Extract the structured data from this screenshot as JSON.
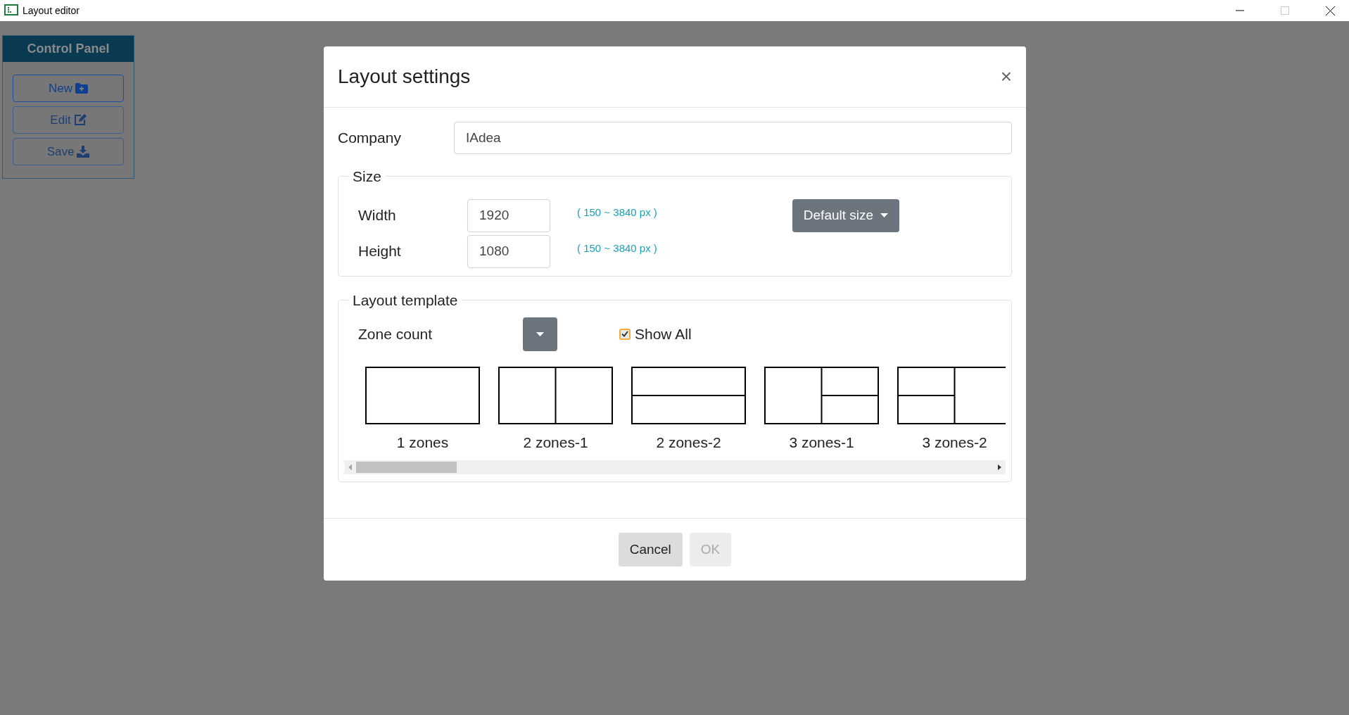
{
  "window": {
    "title": "Layout editor"
  },
  "control_panel": {
    "title": "Control Panel",
    "buttons": [
      {
        "label": "New",
        "kind": "new",
        "disabled": false
      },
      {
        "label": "Edit",
        "kind": "edit",
        "disabled": true
      },
      {
        "label": "Save",
        "kind": "save",
        "disabled": true
      }
    ]
  },
  "dialog": {
    "title": "Layout settings",
    "close": "×",
    "company": {
      "label": "Company",
      "value": "IAdea"
    },
    "size": {
      "legend": "Size",
      "width": {
        "label": "Width",
        "value": "1920",
        "hint": "( 150 ~ 3840 px )"
      },
      "height": {
        "label": "Height",
        "value": "1080",
        "hint": "( 150 ~ 3840 px )"
      },
      "default_button": "Default size"
    },
    "template": {
      "legend": "Layout template",
      "zone_count_label": "Zone count",
      "show_all": {
        "label": "Show All",
        "checked": true
      },
      "templates": [
        {
          "label": "1 zones",
          "kind": "single"
        },
        {
          "label": "2 zones-1",
          "kind": "columns"
        },
        {
          "label": "2 zones-2",
          "kind": "rows"
        },
        {
          "label": "3 zones-1",
          "kind": "left-full"
        },
        {
          "label": "3 zones-2",
          "kind": "right-full"
        }
      ]
    },
    "buttons": [
      {
        "label": "Cancel",
        "disabled": false
      },
      {
        "label": "OK",
        "disabled": true
      }
    ]
  }
}
